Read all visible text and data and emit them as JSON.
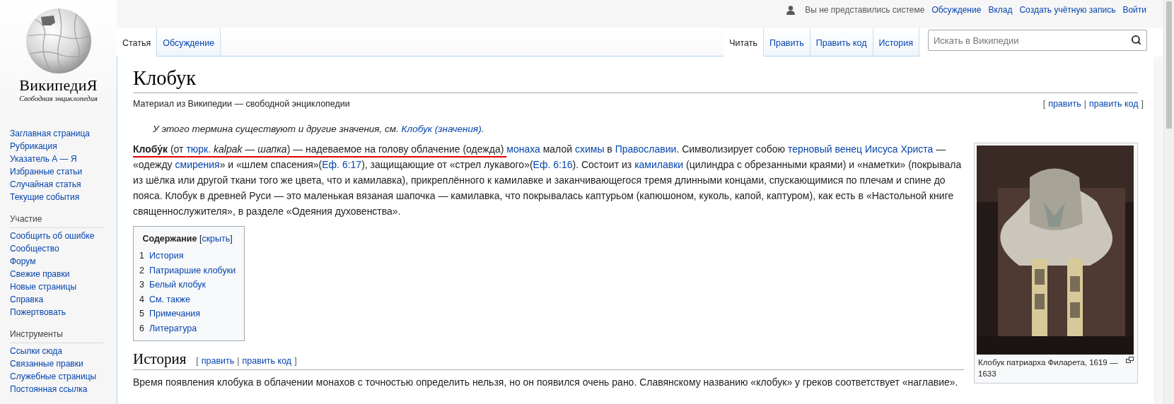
{
  "logo": {
    "wordmark": "ВикипедиЯ",
    "tagline": "Свободная энциклопедия"
  },
  "sidebar": {
    "main_items": [
      "Заглавная страница",
      "Рубрикация",
      "Указатель А — Я",
      "Избранные статьи",
      "Случайная статья",
      "Текущие события"
    ],
    "sections": [
      {
        "heading": "Участие",
        "items": [
          "Сообщить об ошибке",
          "Сообщество",
          "Форум",
          "Свежие правки",
          "Новые страницы",
          "Справка",
          "Пожертвовать"
        ]
      },
      {
        "heading": "Инструменты",
        "items": [
          "Ссылки сюда",
          "Связанные правки",
          "Служебные страницы",
          "Постоянная ссылка"
        ]
      }
    ]
  },
  "personal_bar": {
    "status": "Вы не представились системе",
    "links": [
      "Обсуждение",
      "Вклад",
      "Создать учётную запись",
      "Войти"
    ]
  },
  "namespace_tabs": [
    {
      "label": "Статья",
      "selected": true
    },
    {
      "label": "Обсуждение",
      "selected": false
    }
  ],
  "view_tabs": [
    {
      "label": "Читать",
      "selected": true
    },
    {
      "label": "Править",
      "selected": false
    },
    {
      "label": "Править код",
      "selected": false
    },
    {
      "label": "История",
      "selected": false
    }
  ],
  "search": {
    "placeholder": "Искать в Википедии"
  },
  "article": {
    "title": "Клобук",
    "tagline": "Материал из Википедии — свободной энциклопедии",
    "edit_links": {
      "open": "[",
      "links": [
        "править",
        "править код"
      ],
      "separator": "|",
      "close": "]"
    },
    "hatnote": {
      "text": "У этого термина существуют и другие значения, см. ",
      "link": "Клобук (значения)",
      "end": "."
    },
    "lead": [
      {
        "kind": "bold",
        "text": "Клобу́к",
        "marked": true
      },
      {
        "kind": "text",
        "text": " (от ",
        "marked": true
      },
      {
        "kind": "link",
        "text": "тюрк.",
        "marked": true
      },
      {
        "kind": "italic",
        "text": " kalpak — шапка",
        "marked": true
      },
      {
        "kind": "text",
        "text": ") — надеваемое на голову облачение (одежда) ",
        "marked": true
      },
      {
        "kind": "link",
        "text": "монаха"
      },
      {
        "kind": "text",
        "text": " малой "
      },
      {
        "kind": "link",
        "text": "схимы"
      },
      {
        "kind": "text",
        "text": " в "
      },
      {
        "kind": "link",
        "text": "Православии"
      },
      {
        "kind": "text",
        "text": ". Символизирует собою "
      },
      {
        "kind": "link",
        "text": "терновый венец "
      },
      {
        "kind": "link",
        "text": "Иисуса Христа"
      },
      {
        "kind": "text",
        "text": " — «одежду "
      },
      {
        "kind": "link",
        "text": "смирения"
      },
      {
        "kind": "text",
        "text": "» и «шлем спасения»("
      },
      {
        "kind": "link",
        "text": "Еф. 6:17"
      },
      {
        "kind": "text",
        "text": "), защищающие от «стрел лукавого»("
      },
      {
        "kind": "link",
        "text": "Еф. 6:16"
      },
      {
        "kind": "text",
        "text": "). Состоит из "
      },
      {
        "kind": "link",
        "text": "камилавки"
      },
      {
        "kind": "text",
        "text": " (цилиндра с обрезанными краями) и «наметки» (покрывала из шёлка или другой ткани того же цвета, что и камилавка), прикреплённого к камилавке и заканчивающегося тремя длинными концами, спускающимися по плечам и спине до пояса. Клобук в древней Руси — это маленькая вязаная шапочка — камилавка, что покрывалась каптурьом (капюшоном, куколь, капой, каптуром), как есть в «Настольной книге священнослужителя», в разделе «Одеяния духовенства»."
      }
    ],
    "figure": {
      "kind": "picture",
      "caption": "Клобук патриарха Филарета, 1619 —1633"
    },
    "toc": {
      "title": "Содержание",
      "toggle_open": "[",
      "toggle": "скрыть",
      "toggle_close": "]",
      "items": [
        {
          "number": "1",
          "label": "История"
        },
        {
          "number": "2",
          "label": "Патриаршие клобуки"
        },
        {
          "number": "3",
          "label": "Белый клобук"
        },
        {
          "number": "4",
          "label": "См. также"
        },
        {
          "number": "5",
          "label": "Примечания"
        },
        {
          "number": "6",
          "label": "Литература"
        }
      ]
    },
    "sections": [
      {
        "heading": "История",
        "edit_links": {
          "open": "[",
          "links": [
            "править",
            "править код"
          ],
          "separator": "|",
          "close": "]"
        },
        "text": "Время появления клобука в облачении монахов с точностью определить нельзя, но он появился очень рано. Славянскому названию «клобук» у греков соответствует «наглавие»."
      }
    ]
  }
}
